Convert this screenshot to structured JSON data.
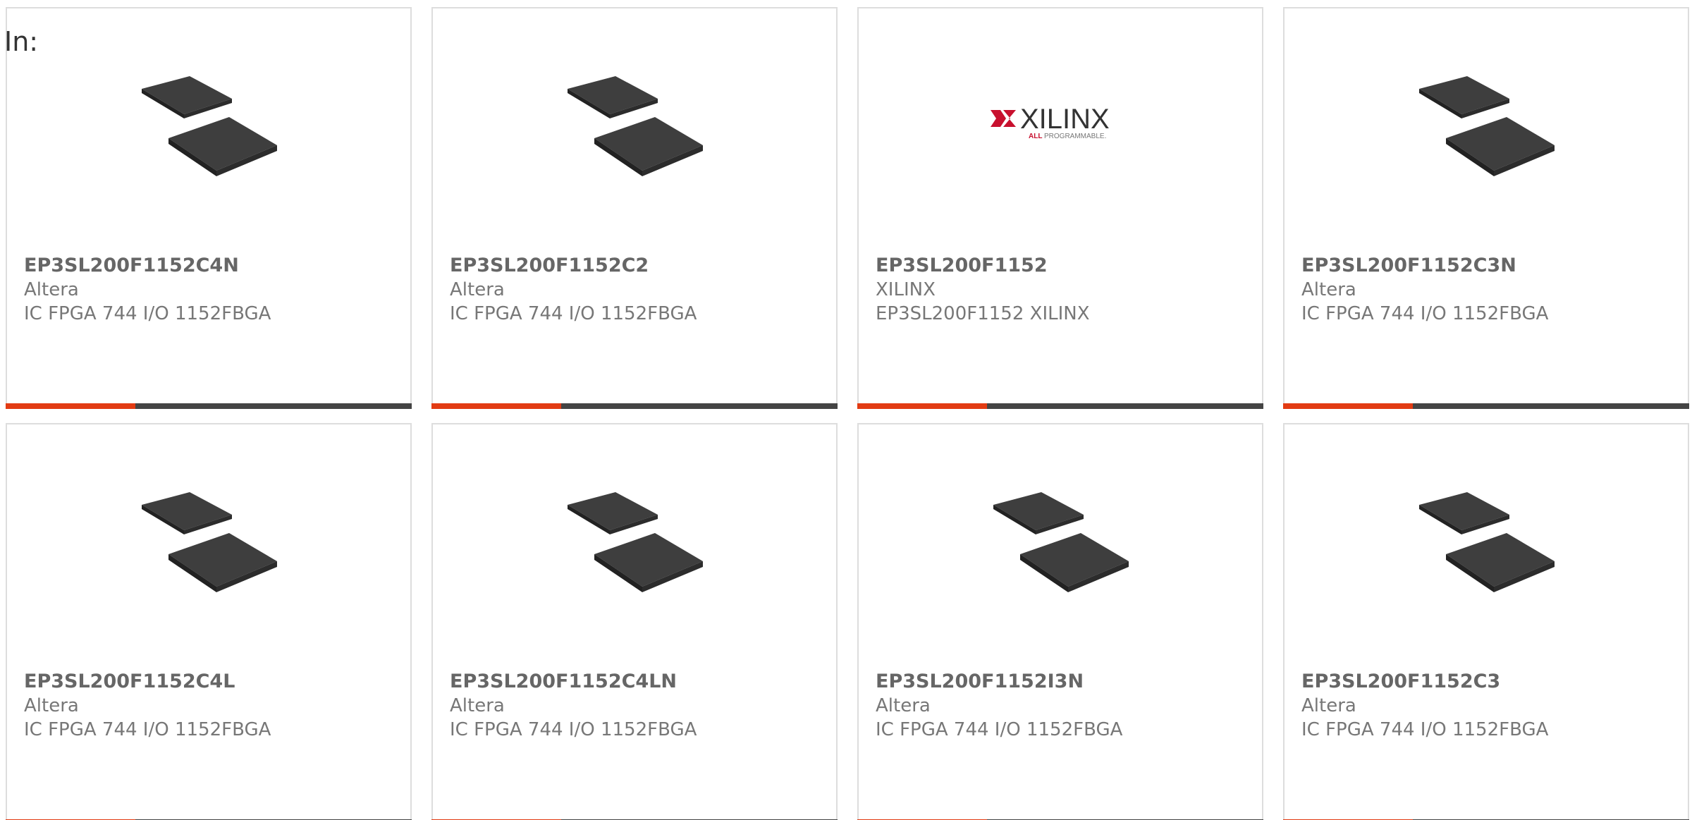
{
  "prefix_label": "In:",
  "colors": {
    "accent": "#e23b13",
    "bar": "#444444",
    "title": "#666666",
    "text": "#777777",
    "xilinx_red": "#c8102e"
  },
  "products": [
    {
      "part_number": "EP3SL200F1152C4N",
      "manufacturer": "Altera",
      "description": "IC FPGA 744 I/O 1152FBGA",
      "image": "bga-chip-icon"
    },
    {
      "part_number": "EP3SL200F1152C2",
      "manufacturer": "Altera",
      "description": "IC FPGA 744 I/O 1152FBGA",
      "image": "bga-chip-icon"
    },
    {
      "part_number": "EP3SL200F1152",
      "manufacturer": "XILINX",
      "description": "EP3SL200F1152 XILINX",
      "image": "xilinx-logo",
      "logo_text": "XILINX",
      "logo_tagline_red": "ALL",
      "logo_tagline": "PROGRAMMABLE."
    },
    {
      "part_number": "EP3SL200F1152C3N",
      "manufacturer": "Altera",
      "description": "IC FPGA 744 I/O 1152FBGA",
      "image": "bga-chip-icon"
    },
    {
      "part_number": "EP3SL200F1152C4L",
      "manufacturer": "Altera",
      "description": "IC FPGA 744 I/O 1152FBGA",
      "image": "bga-chip-icon"
    },
    {
      "part_number": "EP3SL200F1152C4LN",
      "manufacturer": "Altera",
      "description": "IC FPGA 744 I/O 1152FBGA",
      "image": "bga-chip-icon"
    },
    {
      "part_number": "EP3SL200F1152I3N",
      "manufacturer": "Altera",
      "description": "IC FPGA 744 I/O 1152FBGA",
      "image": "bga-chip-icon"
    },
    {
      "part_number": "EP3SL200F1152C3",
      "manufacturer": "Altera",
      "description": "IC FPGA 744 I/O 1152FBGA",
      "image": "bga-chip-icon"
    }
  ]
}
